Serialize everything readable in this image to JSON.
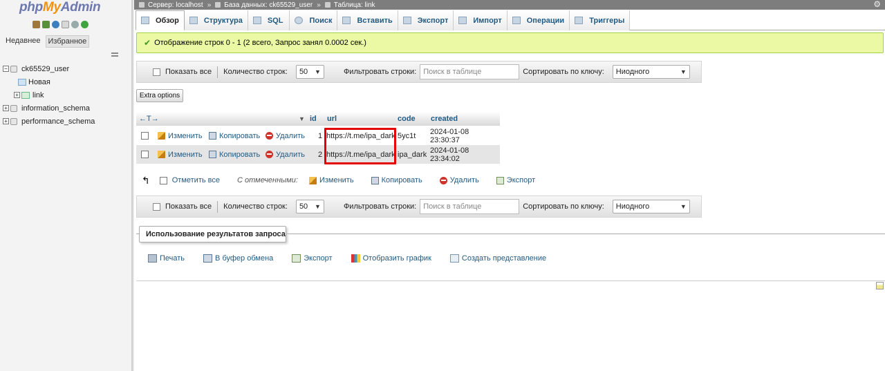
{
  "sidebar": {
    "logo": {
      "php": "php",
      "my": "My",
      "admin": "Admin"
    },
    "tabs": [
      {
        "label": "Недавнее"
      },
      {
        "label": "Избранное"
      }
    ],
    "tree": {
      "db1": "ck65529_user",
      "new_item": "Новая",
      "table_link": "link",
      "db2": "information_schema",
      "db3": "performance_schema"
    }
  },
  "breadcrumb": {
    "server": "Сервер: localhost",
    "database": "База данных: ck65529_user",
    "table": "Таблица: link",
    "separator": "»"
  },
  "tabs": [
    {
      "label": "Обзор",
      "icon": "browse-icon",
      "active": true
    },
    {
      "label": "Структура",
      "icon": "structure-icon"
    },
    {
      "label": "SQL",
      "icon": "sql-icon"
    },
    {
      "label": "Поиск",
      "icon": "search-icon"
    },
    {
      "label": "Вставить",
      "icon": "insert-icon"
    },
    {
      "label": "Экспорт",
      "icon": "export-icon"
    },
    {
      "label": "Импорт",
      "icon": "import-icon"
    },
    {
      "label": "Операции",
      "icon": "operations-icon"
    },
    {
      "label": "Триггеры",
      "icon": "triggers-icon"
    }
  ],
  "message": "Отображение строк 0 - 1 (2 всего, Запрос занял 0.0002 сек.)",
  "navbar": {
    "show_all": "Показать все",
    "row_count_label": "Количество строк:",
    "row_count_value": "50",
    "filter_label": "Фильтровать строки:",
    "filter_placeholder": "Поиск в таблице",
    "sort_label": "Сортировать по ключу:",
    "sort_value": "Ниодного"
  },
  "extra_options": "Extra options",
  "table": {
    "nav_arrows": "←T→",
    "columns": [
      "id",
      "url",
      "code",
      "created"
    ],
    "actions": {
      "edit": "Изменить",
      "copy": "Копировать",
      "delete": "Удалить"
    },
    "rows": [
      {
        "id": "1",
        "url": "https://t.me/ipa_dark",
        "code": "5yc1t",
        "created": "2024-01-08 23:30:37"
      },
      {
        "id": "2",
        "url": "https://t.me/ipa_dark",
        "code": "ipa_dark",
        "created": "2024-01-08 23:34:02"
      }
    ]
  },
  "bulk": {
    "check_all": "Отметить все",
    "with_selected": "С отмеченными:",
    "edit": "Изменить",
    "copy": "Копировать",
    "delete": "Удалить",
    "export": "Экспорт"
  },
  "query_ops": {
    "legend": "Использование результатов запроса",
    "print": "Печать",
    "clipboard": "В буфер обмена",
    "export": "Экспорт",
    "chart": "Отобразить график",
    "create_view": "Создать представление"
  },
  "colors": {
    "accent_link": "#235a81",
    "success_bg": "#ebf8a4",
    "highlight": "#e30000"
  }
}
